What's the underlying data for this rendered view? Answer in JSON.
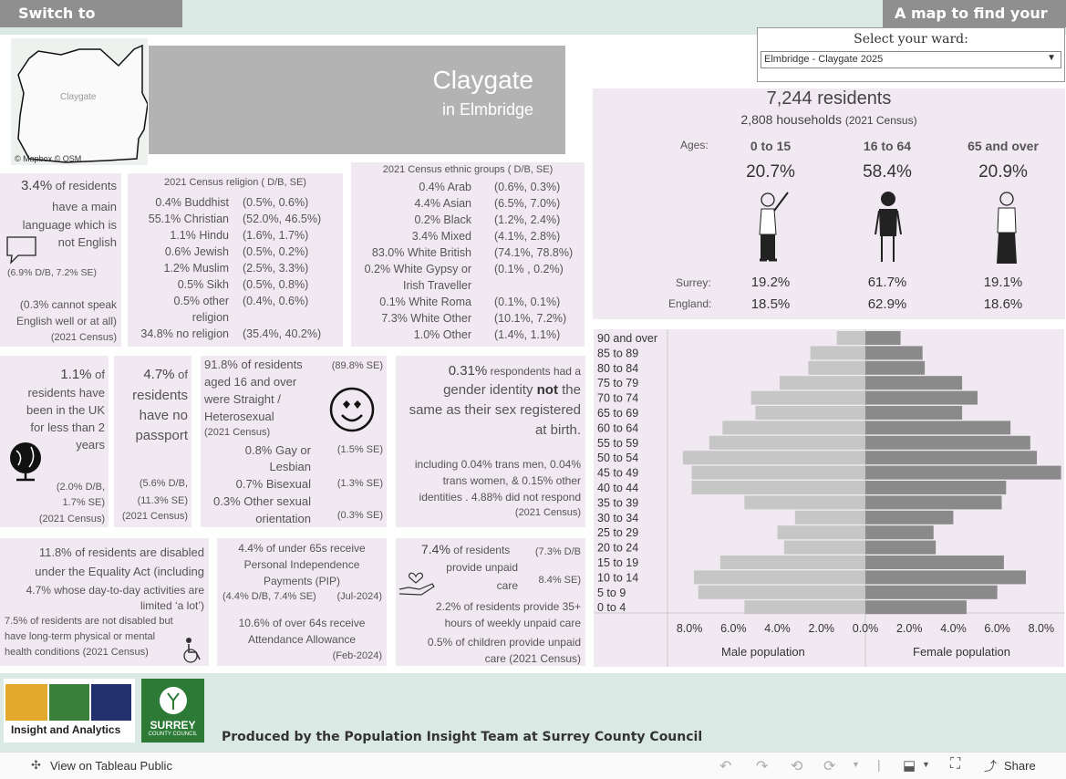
{
  "top": {
    "switch_btn": "Switch to behaviours",
    "map_btn": "A map to find your area",
    "ward_label": "Select your ward:",
    "ward_value": "Elmbridge - Claygate 2025"
  },
  "map": {
    "place": "Claygate",
    "attribution": "© Mapbox  © OSM"
  },
  "title": {
    "ward": "Claygate",
    "district": "in Elmbridge"
  },
  "residents": {
    "count": "7,244 residents",
    "households": "2,808 households",
    "households_note": "(2021 Census)"
  },
  "ages": {
    "label": "Ages:",
    "groups": [
      "0 to 15",
      "16 to 64",
      "65 and over"
    ],
    "values": [
      "20.7%",
      "58.4%",
      "20.9%"
    ],
    "surrey_label": "Surrey:",
    "surrey": [
      "19.2%",
      "61.7%",
      "19.1%"
    ],
    "england_label": "England:",
    "england": [
      "18.5%",
      "62.9%",
      "18.6%"
    ]
  },
  "language": {
    "pct": "3.4%",
    "text1": "of residents",
    "text2": "have a main",
    "text3": "language which is",
    "text4": "not English",
    "comp": "(6.9% D/B,   7.2% SE)",
    "note1": "(0.3% cannot speak",
    "note2": "English well or at all)",
    "note3": "(2021 Census)"
  },
  "religion": {
    "title": "2021 Census religion ( D/B,   SE)",
    "rows": [
      {
        "label": "0.4% Buddhist",
        "comp": "(0.5%,   0.6%)"
      },
      {
        "label": "55.1% Christian",
        "comp": "(52.0%,  46.5%)"
      },
      {
        "label": "1.1% Hindu",
        "comp": "(1.6%,   1.7%)"
      },
      {
        "label": "0.6% Jewish",
        "comp": "(0.5%,   0.2%)"
      },
      {
        "label": "1.2% Muslim",
        "comp": "(2.5%,   3.3%)"
      },
      {
        "label": "0.5% Sikh",
        "comp": "(0.5%,   0.8%)"
      },
      {
        "label": "0.5% other",
        "comp": "(0.4%,   0.6%)"
      },
      {
        "label": "religion",
        "comp": ""
      },
      {
        "label": "34.8% no religion",
        "comp": "(35.4%,   40.2%)"
      }
    ]
  },
  "ethnic": {
    "title": "2021 Census ethnic groups ( D/B,    SE)",
    "rows": [
      {
        "label": "0.4% Arab",
        "comp": "(0.6%,   0.3%)"
      },
      {
        "label": "4.4% Asian",
        "comp": "(6.5%,   7.0%)"
      },
      {
        "label": "0.2% Black",
        "comp": "(1.2%,   2.4%)"
      },
      {
        "label": "3.4% Mixed",
        "comp": "(4.1%,   2.8%)"
      },
      {
        "label": "83.0% White British",
        "comp": "(74.1%,  78.8%)"
      },
      {
        "label": "0.2% White Gypsy or",
        "comp": "(0.1% ,   0.2%)"
      },
      {
        "label": "Irish Traveller",
        "comp": ""
      },
      {
        "label": "0.1% White Roma",
        "comp": "(0.1%,   0.1%)"
      },
      {
        "label": "7.3% White Other",
        "comp": "(10.1%,   7.2%)"
      },
      {
        "label": "1.0% Other",
        "comp": "(1.4%,   1.1%)"
      }
    ]
  },
  "uk": {
    "pct": "1.1%",
    "l1": "of",
    "l2": "residents have",
    "l3": "been in the UK",
    "l4": "for less than 2",
    "l5": "years",
    "c1": "(2.0%  D/B,",
    "c2": "1.7% SE)",
    "c3": "(2021 Census)"
  },
  "passport": {
    "pct": "4.7%",
    "l1": "of",
    "l2": "residents",
    "l3": "have no",
    "l4": "passport",
    "c1": "(5.6% D/B,",
    "c2": "(11.3% SE)",
    "c3": "(2021 Census)"
  },
  "orientation": {
    "l1": "91.8% of residents",
    "l2": "aged 16 and over",
    "l3": "were Straight /",
    "l4": "Heterosexual",
    "l5": "(2021 Census)",
    "se1": "(89.8% SE)",
    "gay1": "0.8% Gay or",
    "gay2": "Lesbian",
    "se2": "(1.5% SE)",
    "bi": "0.7% Bisexual",
    "se3": "(1.3% SE)",
    "oth1": "0.3% Other sexual",
    "oth2": "orientation",
    "se4": "(0.3% SE)"
  },
  "gender": {
    "pct": "0.31%",
    "l1": "respondents had a",
    "l2a": "gender identity ",
    "l2b": "not",
    "l2c": " the",
    "l3": "same as their sex registered",
    "l4": "at birth.",
    "n1": "including 0.04% trans men, 0.04%",
    "n2": "trans women, & 0.15% other",
    "n3": "identities . 4.88% did not respond",
    "n4": "(2021 Census)"
  },
  "disabled": {
    "l1": "11.8% of residents are disabled",
    "l2": "under the Equality Act (including",
    "l3": "4.7% whose day-to-day activities are",
    "l4": "limited ‘a lot’)",
    "n1": "7.5% of residents are not disabled but",
    "n2": "have long-term physical or mental",
    "n3": "health conditions (2021 Census)"
  },
  "pip": {
    "l1": "4.4% of under 65s receive",
    "l2": "Personal Independence",
    "l3": "Payments (PIP)",
    "l4": "(4.4% D/B,   7.4% SE)",
    "l5": "(Jul-2024)",
    "a1": "10.6% of over 64s receive",
    "a2": "Attendance Allowance",
    "a3": "(Feb-2024)"
  },
  "carers": {
    "pct": "7.4%",
    "l1": "of residents",
    "l2": "provide unpaid",
    "l3": "care",
    "c1": "(7.3% D/B",
    "c2": "8.4% SE)",
    "n1": "2.2% of residents provide 35+",
    "n2": "hours of weekly unpaid care",
    "n3": "0.5% of children provide unpaid",
    "n4": "care (2021 Census)"
  },
  "chart_data": {
    "type": "bar",
    "categories": [
      "90 and over",
      "85 to 89",
      "80 to 84",
      "75 to 79",
      "70 to 74",
      "65 to 69",
      "60 to 64",
      "55 to 59",
      "50 to 54",
      "45 to 49",
      "40 to 44",
      "35 to 39",
      "30 to 34",
      "25 to 29",
      "20 to 24",
      "15 to 19",
      "10 to 14",
      "5 to 9",
      "0 to 4"
    ],
    "series": [
      {
        "name": "Male population",
        "values": [
          1.3,
          2.5,
          2.6,
          3.9,
          5.2,
          5.0,
          6.5,
          7.1,
          8.3,
          7.9,
          7.9,
          5.5,
          3.2,
          4.0,
          3.7,
          6.6,
          7.8,
          7.6,
          5.5
        ]
      },
      {
        "name": "Female population",
        "values": [
          1.6,
          2.6,
          2.7,
          4.4,
          5.1,
          4.4,
          6.6,
          7.5,
          7.8,
          8.9,
          6.4,
          6.2,
          4.0,
          3.1,
          3.2,
          6.3,
          7.3,
          6.0,
          4.6
        ]
      }
    ],
    "xticks_left": [
      "8.0%",
      "6.0%",
      "4.0%",
      "2.0%",
      "0.0%"
    ],
    "xticks_right": [
      "2.0%",
      "4.0%",
      "6.0%",
      "8.0%"
    ],
    "xmax": 9.0
  },
  "footer": {
    "logo_text": "Insight and Analytics",
    "surrey1": "SURREY",
    "surrey2": "COUNTY COUNCIL",
    "produced": "Produced by the Population Insight Team at Surrey County Council"
  },
  "toolbar": {
    "view": "View on Tableau Public",
    "share": "Share"
  }
}
